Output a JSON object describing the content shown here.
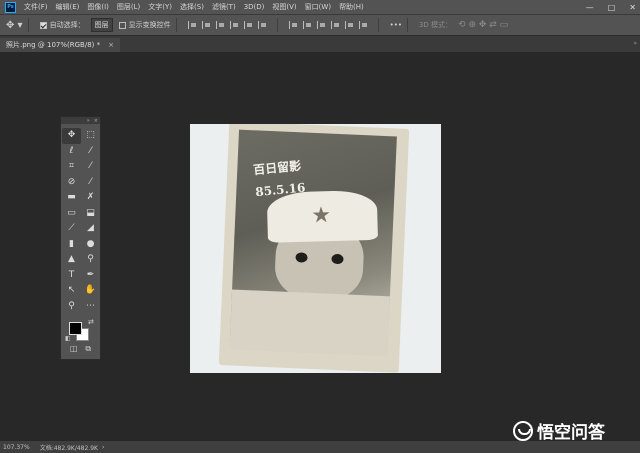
{
  "menubar": {
    "logo": "Ps",
    "items": [
      "文件(F)",
      "编辑(E)",
      "图像(I)",
      "图层(L)",
      "文字(Y)",
      "选择(S)",
      "滤镜(T)",
      "3D(D)",
      "视图(V)",
      "窗口(W)",
      "帮助(H)"
    ],
    "window_controls": [
      "—",
      "□",
      "✕"
    ]
  },
  "options": {
    "auto_select_label": "自动选择：",
    "auto_select_value": "图层",
    "show_transform_label": "显示变换控件",
    "more": "•••",
    "mode_3d": "3D 模式："
  },
  "document_tab": {
    "title": "照片.png @ 107%(RGB/8) *",
    "close": "×"
  },
  "status": {
    "zoom": "107.37%",
    "doc_info": "文档:482.9K/482.9K"
  },
  "photo": {
    "handwriting_line1": "百日留影",
    "handwriting_line2": "85.5.16"
  },
  "tools": [
    {
      "name": "move-tool",
      "glyph": "✥"
    },
    {
      "name": "marquee-tool",
      "glyph": "⬚"
    },
    {
      "name": "lasso-tool",
      "glyph": "ℓ"
    },
    {
      "name": "quick-select-tool",
      "glyph": "⁄"
    },
    {
      "name": "crop-tool",
      "glyph": "⌗"
    },
    {
      "name": "eyedropper-tool",
      "glyph": "⁄"
    },
    {
      "name": "healing-brush-tool",
      "glyph": "⊘"
    },
    {
      "name": "brush-tool",
      "glyph": "⁄"
    },
    {
      "name": "clone-stamp-tool",
      "glyph": "▬"
    },
    {
      "name": "history-brush-tool",
      "glyph": "✗"
    },
    {
      "name": "eraser-tool",
      "glyph": "▭"
    },
    {
      "name": "paint-bucket-tool",
      "glyph": "⬓"
    },
    {
      "name": "blur-tool",
      "glyph": "⟋"
    },
    {
      "name": "dodge-tool",
      "glyph": "◢"
    },
    {
      "name": "gradient-tool",
      "glyph": "▮"
    },
    {
      "name": "drop-tool",
      "glyph": "●"
    },
    {
      "name": "triangle-tool",
      "glyph": "▲"
    },
    {
      "name": "zoom-search-tool",
      "glyph": "⚲"
    },
    {
      "name": "type-tool",
      "glyph": "T"
    },
    {
      "name": "pen-tool",
      "glyph": "✒"
    },
    {
      "name": "path-select-tool",
      "glyph": "↖"
    },
    {
      "name": "hand-tool",
      "glyph": "✋"
    },
    {
      "name": "zoom-tool",
      "glyph": "⚲"
    },
    {
      "name": "more-tools",
      "glyph": "⋯"
    }
  ],
  "watermark": {
    "text": "悟空问答"
  },
  "colors": {
    "foreground": "#000000",
    "background": "#ffffff",
    "ps_blue": "#31a8ff"
  }
}
